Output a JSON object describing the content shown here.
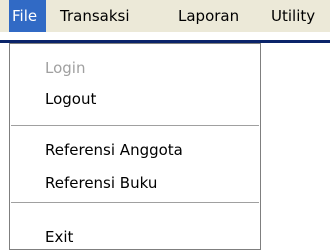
{
  "menubar": {
    "items": [
      {
        "label": "File"
      },
      {
        "label": "Transaksi"
      },
      {
        "label": "Laporan"
      },
      {
        "label": "Utility"
      }
    ]
  },
  "file_menu": {
    "items": [
      {
        "label": "Login",
        "enabled": false
      },
      {
        "label": "Logout",
        "enabled": true
      },
      {
        "label": "Referensi Anggota",
        "enabled": true
      },
      {
        "label": "Referensi Buku",
        "enabled": true
      },
      {
        "label": "Exit",
        "enabled": true
      }
    ]
  },
  "colors": {
    "menubar_background": "#ece9d8",
    "highlight": "#316ac5",
    "disabled_text": "#a0a0a0"
  }
}
